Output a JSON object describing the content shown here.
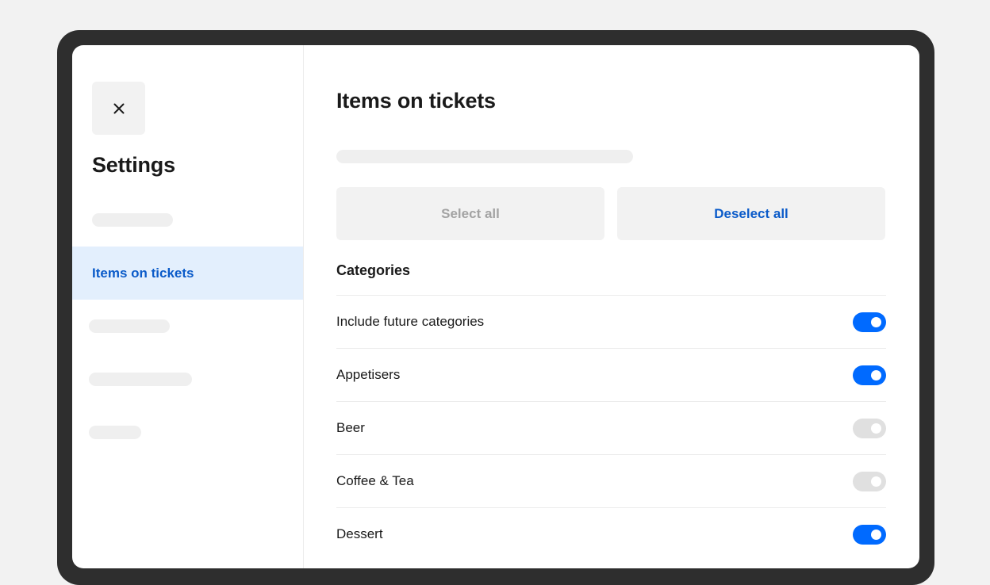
{
  "sidebar": {
    "close_icon": "close-icon",
    "title": "Settings",
    "active_item": "Items on tickets"
  },
  "main": {
    "title": "Items on tickets",
    "select_all_label": "Select all",
    "deselect_all_label": "Deselect all",
    "section_title": "Categories",
    "categories": [
      {
        "label": "Include future categories",
        "enabled": true
      },
      {
        "label": "Appetisers",
        "enabled": true
      },
      {
        "label": "Beer",
        "enabled": false
      },
      {
        "label": "Coffee & Tea",
        "enabled": false
      },
      {
        "label": "Dessert",
        "enabled": true
      }
    ]
  },
  "colors": {
    "accent": "#006aff",
    "link": "#0b5bc9",
    "active_nav_bg": "#e3effd",
    "toggle_off": "#e0e0e0"
  }
}
